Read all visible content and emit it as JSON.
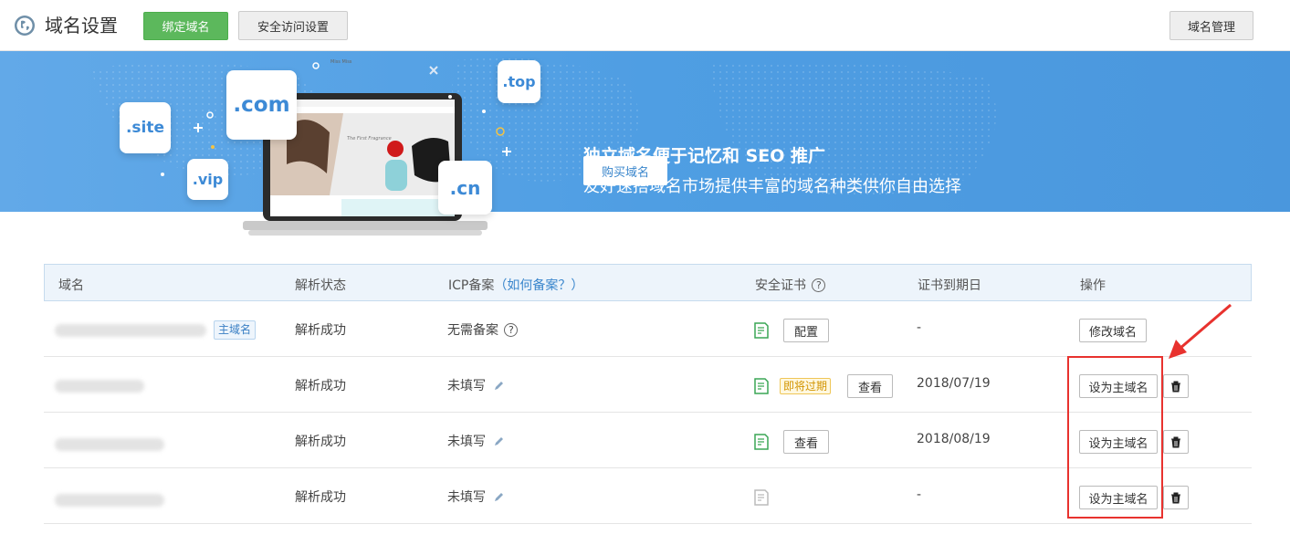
{
  "header": {
    "title": "域名设置",
    "bind_label": "绑定域名",
    "security_label": "安全访问设置",
    "manage_label": "域名管理"
  },
  "banner": {
    "title": "独立域名便于记忆和 SEO 推广",
    "subtitle": "友好速搭域名市场提供丰富的域名种类供你自由选择",
    "buy_label": "购买域名",
    "tlds": [
      ".site",
      ".com",
      ".vip",
      ".top",
      ".cn"
    ],
    "mock_brand": "Miss Miss",
    "mock_tagline": "The First Fragrance"
  },
  "table": {
    "headers": {
      "domain": "域名",
      "status": "解析状态",
      "icp": "ICP备案",
      "icp_help": "（如何备案？）",
      "cert": "安全证书",
      "expiry": "证书到期日",
      "actions": "操作"
    },
    "help_glyph": "?",
    "main_tag": "主域名",
    "rows": [
      {
        "status": "解析成功",
        "icp": "无需备案",
        "cert_button": "配置",
        "expiry": "-",
        "action": "修改域名"
      },
      {
        "status": "解析成功",
        "icp": "未填写",
        "cert_badge": "即将过期",
        "cert_button": "查看",
        "expiry": "2018/07/19",
        "action": "设为主域名"
      },
      {
        "status": "解析成功",
        "icp": "未填写",
        "cert_button": "查看",
        "expiry": "2018/08/19",
        "action": "设为主域名"
      },
      {
        "status": "解析成功",
        "icp": "未填写",
        "expiry": "-",
        "action": "设为主域名"
      }
    ]
  },
  "colors": {
    "primary_green": "#5cb85c",
    "banner_blue": "#4f9ee3",
    "link_blue": "#3a86cc",
    "highlight_red": "#e8322e",
    "cert_green": "#3aa655"
  },
  "icons": [
    "globe-icon",
    "certificate-icon",
    "pencil-icon",
    "help-icon",
    "trash-icon",
    "arrow-icon"
  ]
}
